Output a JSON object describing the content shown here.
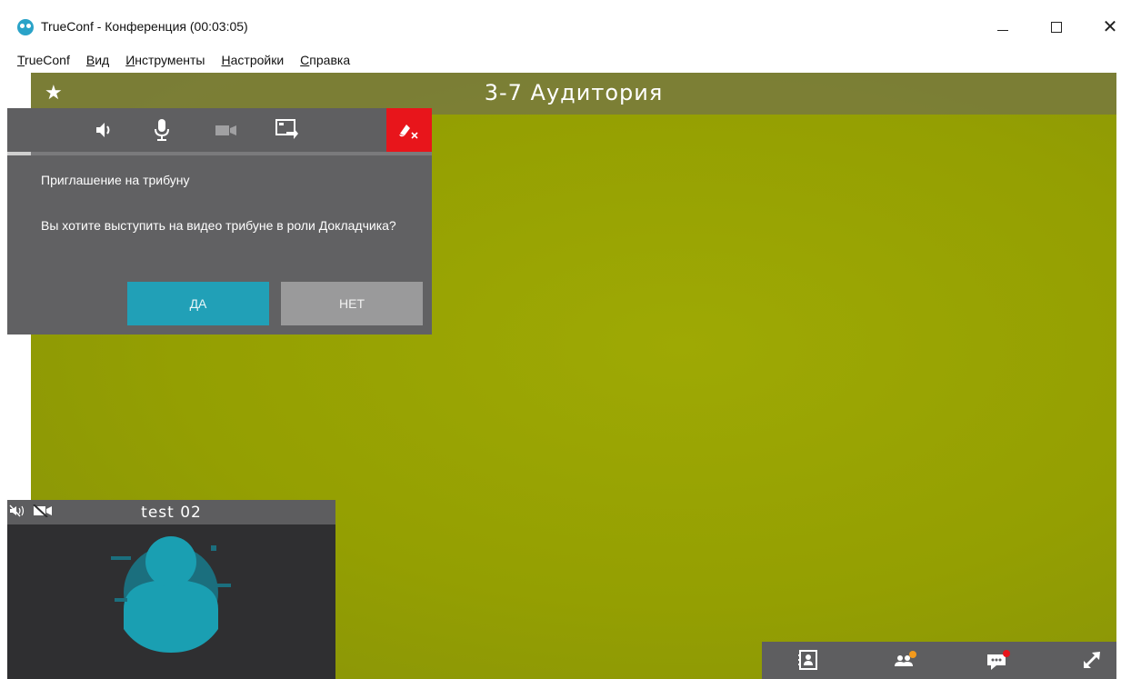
{
  "window": {
    "title": "TrueConf - Конференция (00:03:05)",
    "minimize_icon": "minimize-icon",
    "maximize_icon": "maximize-icon",
    "close_icon": "close-icon",
    "close_glyph": "✕"
  },
  "menu": {
    "items": [
      {
        "label": "TrueConf",
        "underline": "T"
      },
      {
        "label": "Вид",
        "underline": "В"
      },
      {
        "label": "Инструменты",
        "underline": "И"
      },
      {
        "label": "Настройки",
        "underline": "Н"
      },
      {
        "label": "Справка",
        "underline": "С"
      }
    ]
  },
  "conference": {
    "title": "3-7 Аудитория",
    "favorite_icon": "star-icon",
    "star_glyph": "★"
  },
  "toolbar": {
    "icons": [
      "speaker-icon",
      "microphone-icon",
      "camera-off-icon",
      "screen-share-icon",
      "hang-up-icon"
    ]
  },
  "dialog": {
    "title": "Приглашение на трибуну",
    "message": "Вы хотите выступить на видео трибуне в роли Докладчика?",
    "yes_label": "ДА",
    "no_label": "НЕТ"
  },
  "self_view": {
    "name": "test 02",
    "icons": [
      "speaker-muted-icon",
      "camera-muted-icon"
    ],
    "avatar": "user-avatar-icon"
  },
  "bottom_bar": {
    "icons": [
      "contacts-icon",
      "participants-icon",
      "chat-icon",
      "fullscreen-icon"
    ]
  },
  "colors": {
    "video_bg": "#9ea904",
    "accent": "#21a0b7",
    "hangup": "#e8151b",
    "notification": "#e8151b"
  }
}
